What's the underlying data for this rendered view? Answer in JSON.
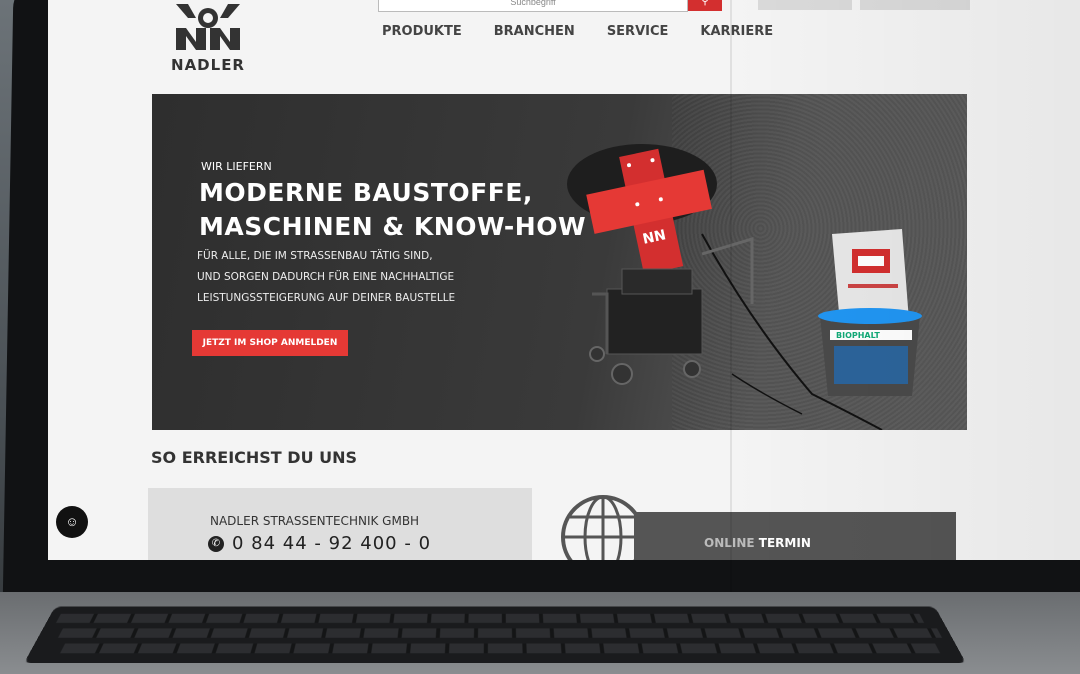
{
  "brand": {
    "name": "NADLER"
  },
  "search": {
    "placeholder": "Suchbegriff"
  },
  "nav": {
    "items": [
      "PRODUKTE",
      "BRANCHEN",
      "SERVICE",
      "KARRIERE"
    ]
  },
  "hero": {
    "kicker": "WIR LIEFERN",
    "headline_line1": "MODERNE BAUSTOFFE,",
    "headline_line2": "MASCHINEN & KNOW-HOW",
    "sub_line1": "FÜR ALLE, DIE IM STRASSENBAU TÄTIG SIND,",
    "sub_line2": "UND SORGEN DADURCH FÜR EINE NACHHALTIGE",
    "sub_line3": "LEISTUNGSSTEIGERUNG AUF DEINER BAUSTELLE",
    "cta": "JETZT IM SHOP ANMELDEN",
    "product_label": "BIOPHALT"
  },
  "contact": {
    "section_title": "SO ERREICHST DU UNS",
    "company": "NADLER STRASSENTECHNIK GMBH",
    "phone": "0 84 44 - 92 400 - 0"
  },
  "online": {
    "label_dim": "ONLINE",
    "label": "TERMIN"
  },
  "colors": {
    "accent": "#e53935",
    "hero_bg": "#333333",
    "panel": "#555555"
  },
  "icons": {
    "chat": "chat-bubble-icon",
    "phone": "phone-icon",
    "globe": "globe-icon",
    "search": "search-icon"
  }
}
